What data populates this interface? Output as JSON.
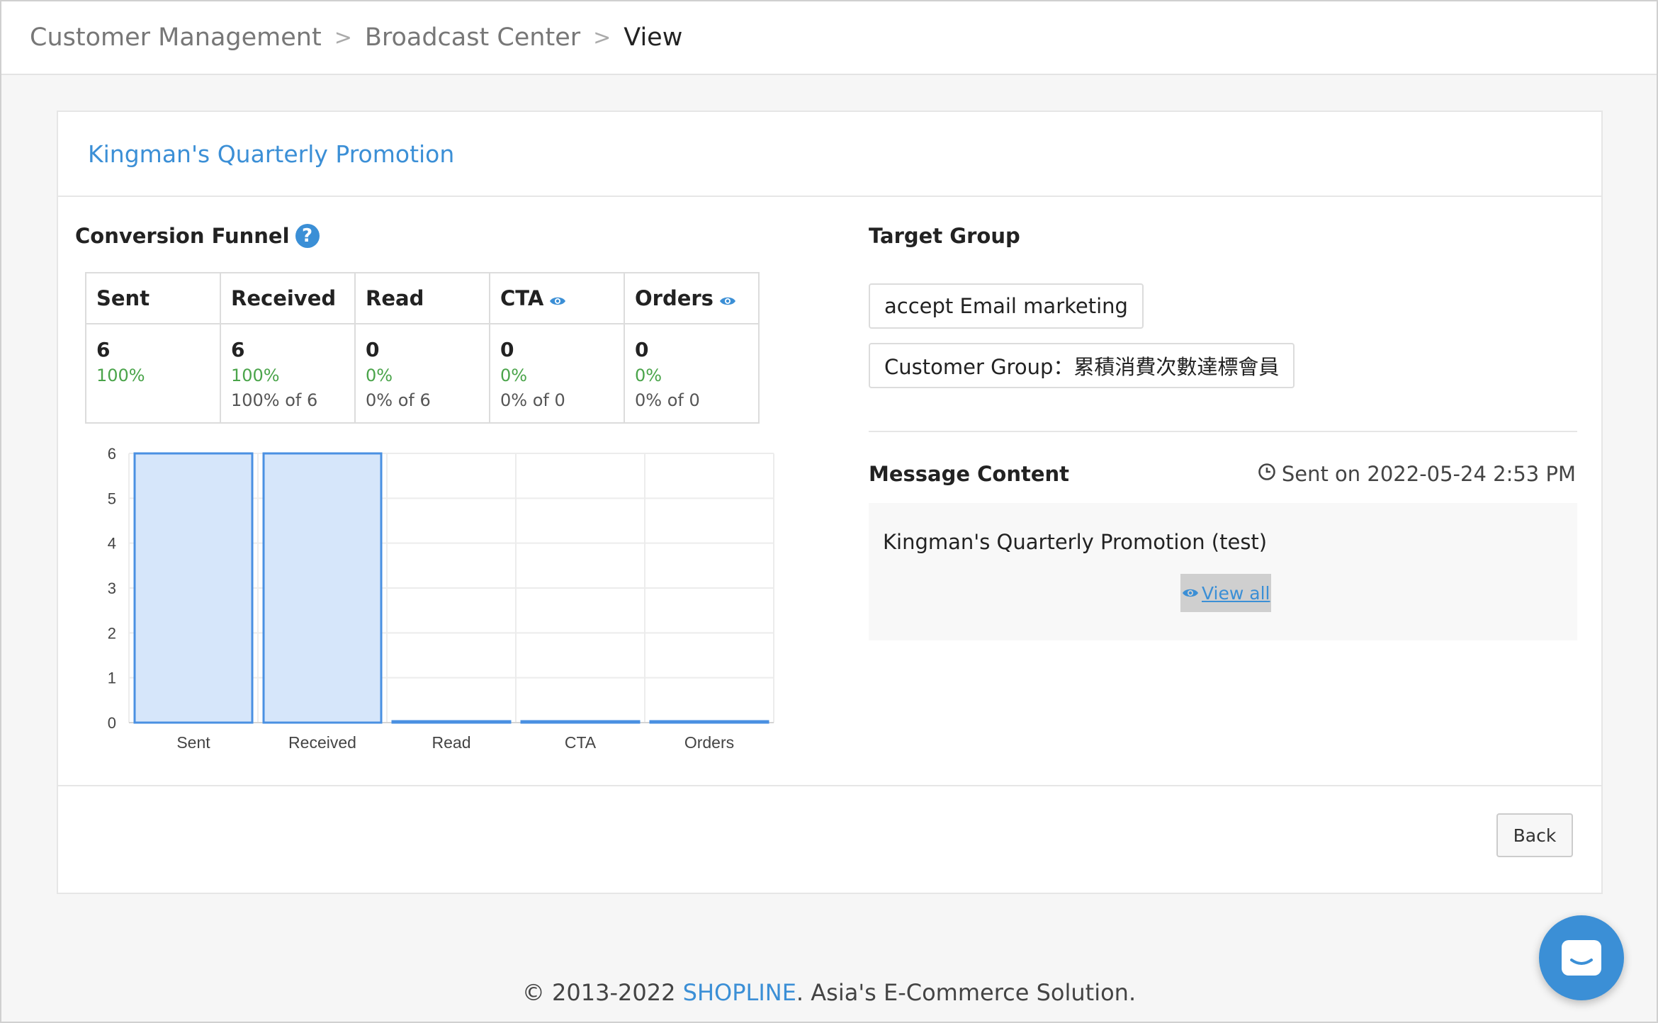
{
  "breadcrumb": {
    "items": [
      "Customer Management",
      "Broadcast Center"
    ],
    "current": "View"
  },
  "card": {
    "title": "Kingman's Quarterly Promotion"
  },
  "funnel": {
    "title": "Conversion Funnel",
    "columns": [
      {
        "label": "Sent",
        "count": "6",
        "percent": "100%",
        "sub": ""
      },
      {
        "label": "Received",
        "count": "6",
        "percent": "100%",
        "sub": "100% of 6"
      },
      {
        "label": "Read",
        "count": "0",
        "percent": "0%",
        "sub": "0% of 6"
      },
      {
        "label": "CTA",
        "count": "0",
        "percent": "0%",
        "sub": "0% of 0"
      },
      {
        "label": "Orders",
        "count": "0",
        "percent": "0%",
        "sub": "0% of 0"
      }
    ]
  },
  "chart_data": {
    "type": "bar",
    "categories": [
      "Sent",
      "Received",
      "Read",
      "CTA",
      "Orders"
    ],
    "values": [
      6,
      6,
      0,
      0,
      0
    ],
    "title": "",
    "xlabel": "",
    "ylabel": "",
    "ylim": [
      0,
      6
    ],
    "yticks": [
      "0",
      "1",
      "2",
      "3",
      "4",
      "5",
      "6"
    ],
    "grid": true,
    "bar_color": "#d6e6fa",
    "bar_border": "#4a90e2"
  },
  "target_group": {
    "title": "Target Group",
    "tags": [
      "accept Email marketing",
      "Customer Group：累積消費次數達標會員"
    ]
  },
  "message": {
    "title": "Message Content",
    "sent_on": "Sent on 2022-05-24 2:53 PM",
    "text": "Kingman's Quarterly Promotion (test)",
    "view_all": "View all"
  },
  "actions": {
    "back": "Back"
  },
  "footer": {
    "prefix": "© 2013-2022 ",
    "brand": "SHOPLINE",
    "suffix": ". Asia's E-Commerce Solution."
  },
  "colors": {
    "accent": "#3b8fd6",
    "success": "#4aa44a"
  }
}
